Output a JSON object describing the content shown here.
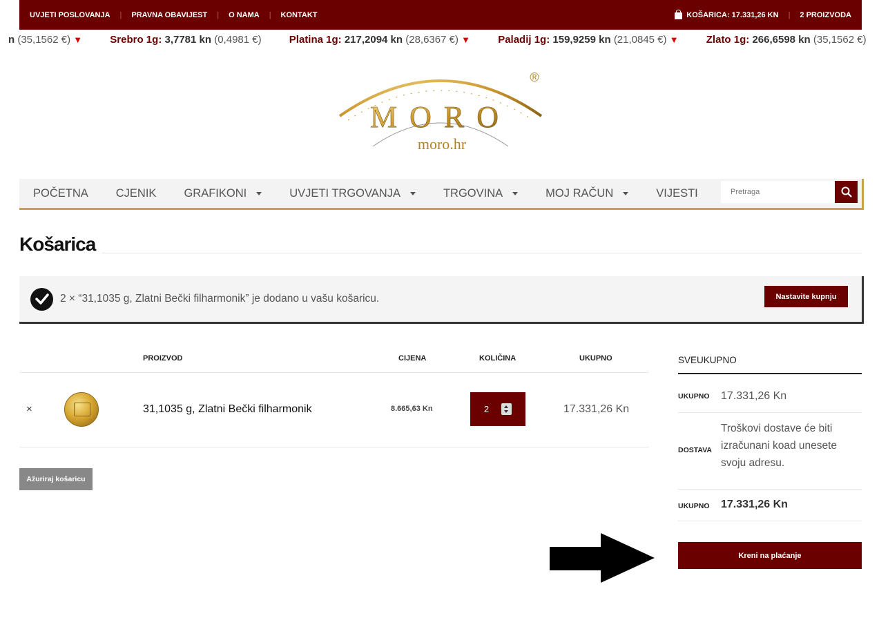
{
  "topbar": {
    "links": [
      "UVJETI POSLOVANJA",
      "PRAVNA OBAVIJEST",
      "O NAMA",
      "KONTAKT"
    ],
    "cart_label": "KOŠARICA: 17.331,26 KN",
    "cart_count": "2 PROIZVODA"
  },
  "ticker": {
    "items": [
      {
        "metal": "",
        "value": "n",
        "eur": "(35,1562 €)"
      },
      {
        "metal": "Srebro 1g:",
        "value": "3,7781 kn",
        "eur": "(0,4981 €)"
      },
      {
        "metal": "Platina 1g:",
        "value": "217,2094 kn",
        "eur": "(28,6367 €)"
      },
      {
        "metal": "Paladij 1g:",
        "value": "159,9259 kn",
        "eur": "(21,0845 €)"
      },
      {
        "metal": "Zlato 1g:",
        "value": "266,6598 kn",
        "eur": "(35,1562 €)"
      }
    ],
    "trend_symbol": "▼"
  },
  "logo": {
    "word": "MORO",
    "domain": "moro.hr",
    "registered": "®"
  },
  "nav": {
    "items": [
      {
        "label": "POČETNA",
        "dropdown": false
      },
      {
        "label": "CJENIK",
        "dropdown": false
      },
      {
        "label": "GRAFIKONI",
        "dropdown": true
      },
      {
        "label": "UVJETI TRGOVANJA",
        "dropdown": true
      },
      {
        "label": "TRGOVINA",
        "dropdown": true
      },
      {
        "label": "MOJ RAČUN",
        "dropdown": true
      },
      {
        "label": "VIJESTI",
        "dropdown": false
      }
    ],
    "search_placeholder": "Pretraga"
  },
  "page": {
    "title": "Košarica"
  },
  "notice": {
    "message": "2 × “31,1035 g, Zlatni Bečki filharmonik” je dodano u vašu košaricu.",
    "button": "Nastavite kupnju"
  },
  "cart": {
    "headers": {
      "product": "PROIZVOD",
      "price": "CIJENA",
      "quantity": "KOLIČINA",
      "total": "UKUPNO"
    },
    "items": [
      {
        "remove": "×",
        "name": "31,1035 g, Zlatni Bečki filharmonik",
        "price": "8.665,63 Kn",
        "quantity": "2",
        "total": "17.331,26 Kn"
      }
    ],
    "update_button": "Ažuriraj košaricu"
  },
  "totals": {
    "title": "SVEUKUPNO",
    "subtotal_label": "UKUPNO",
    "subtotal_value": "17.331,26 Kn",
    "shipping_label": "DOSTAVA",
    "shipping_value": "Troškovi dostave će biti izračunani koad unesete svoju adresu.",
    "total_label": "UKUPNO",
    "total_value": "17.331,26 Kn",
    "checkout_button": "Kreni na plaćanje"
  },
  "colors": {
    "brand": "#6b0000",
    "gold": "#c9a14a",
    "down": "#dd0000"
  }
}
